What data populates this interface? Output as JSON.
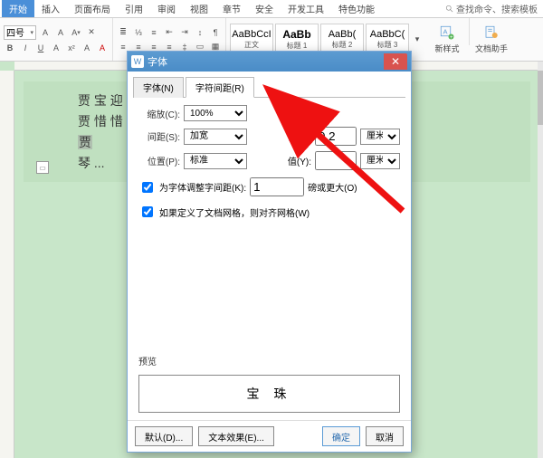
{
  "ribbon": {
    "tabs": [
      "开始",
      "插入",
      "页面布局",
      "引用",
      "审阅",
      "视图",
      "章节",
      "安全",
      "开发工具",
      "特色功能"
    ],
    "active_tab": "开始",
    "search_placeholder": "查找命令、搜索模板",
    "font_size": "四号",
    "icons_row1": [
      "A",
      "A",
      "A⁻",
      "A⁺"
    ],
    "align_labels": [
      "左对齐",
      "居中",
      "右对齐",
      "两端"
    ],
    "styles": [
      {
        "sample": "AaBbCcI",
        "label": "正文"
      },
      {
        "sample": "AaBb",
        "label": "标题 1"
      },
      {
        "sample": "AaBb(",
        "label": "标题 2"
      },
      {
        "sample": "AaBbC(",
        "label": "标题 3"
      }
    ],
    "new_style": "新样式",
    "doc_assistant": "文档助手"
  },
  "document": {
    "lines": [
      "贾 宝                                             迎 春",
      "贾 惜                                             惜 春",
      "贾                                                善 报",
      "琴  ..."
    ],
    "selected_word": "贾"
  },
  "dialog": {
    "title": "字体",
    "tabs": [
      "字体(N)",
      "字符间距(R)"
    ],
    "active_tab": "字符间距(R)",
    "scale": {
      "label": "缩放(C):",
      "value": "100%"
    },
    "spacing": {
      "label": "间距(S):",
      "value": "加宽",
      "by_label": "值(B):",
      "by_value": "0.2",
      "unit": "厘米"
    },
    "position": {
      "label": "位置(P):",
      "value": "标准",
      "by_label": "值(Y):",
      "by_value": "",
      "unit": "厘米"
    },
    "kerning": {
      "label": "为字体调整字间距(K):",
      "value": "1",
      "unit_label": "磅或更大(O)"
    },
    "snap": {
      "label": "如果定义了文档网格，则对齐网格(W)"
    },
    "preview_label": "预览",
    "preview_text": "宝 珠",
    "buttons": {
      "default": "默认(D)...",
      "text_effect": "文本效果(E)...",
      "ok": "确定",
      "cancel": "取消"
    }
  }
}
